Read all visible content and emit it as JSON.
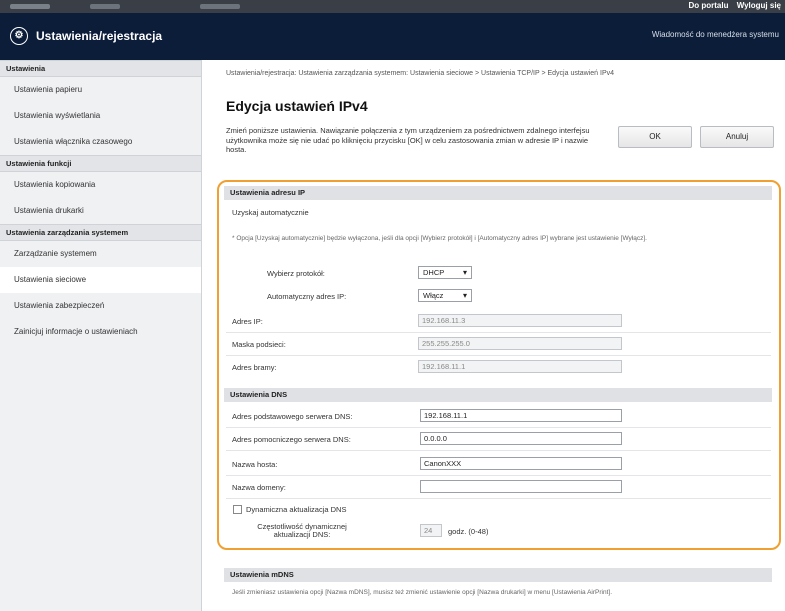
{
  "topbar": {
    "portal_link": "Do portalu",
    "logout_link": "Wyloguj się"
  },
  "app": {
    "title": "Ustawienia/rejestracja",
    "logo_icon": "settings-gear-icon",
    "admin_message": "Wiadomość do menedżera systemu"
  },
  "sidebar": {
    "sections": [
      {
        "label": "Ustawienia",
        "items": [
          "Ustawienia papieru",
          "Ustawienia wyświetlania",
          "Ustawienia włącznika czasowego"
        ]
      },
      {
        "label": "Ustawienia funkcji",
        "items": [
          "Ustawienia kopiowania",
          "Ustawienia drukarki"
        ]
      },
      {
        "label": "Ustawienia zarządzania systemem",
        "items": [
          "Zarządzanie systemem",
          "Ustawienia sieciowe",
          "Ustawienia zabezpieczeń",
          "Zainicjuj informacje o ustawieniach"
        ]
      }
    ],
    "active_item": "Ustawienia sieciowe"
  },
  "main": {
    "breadcrumb": "Ustawienia/rejestracja: Ustawienia zarządzania systemem: Ustawienia sieciowe > Ustawienia TCP/IP > Edycja ustawień IPv4",
    "page_title": "Edycja ustawień IPv4",
    "description": "Zmień poniższe ustawienia. Nawiązanie połączenia z tym urządzeniem za pośrednictwem zdalnego interfejsu użytkownika może się nie udać po kliknięciu przycisku [OK] w celu zastosowania zmian w adresie IP i nazwie hosta.",
    "ok_button": "OK",
    "cancel_button": "Anuluj"
  },
  "ip_settings": {
    "header": "Ustawienia adresu IP",
    "auto_label": "Uzyskaj automatycznie",
    "note": "* Opcja [Uzyskaj automatycznie] będzie wyłączona, jeśli dla opcji [Wybierz protokół] i [Automatyczny adres IP] wybrane jest ustawienie [Wyłącz].",
    "protocol_label": "Wybierz protokół:",
    "protocol_value": "DHCP",
    "auto_ip_label": "Automatyczny adres IP:",
    "auto_ip_value": "Włącz",
    "ip_label": "Adres IP:",
    "ip_value": "192.168.11.3",
    "mask_label": "Maska podsieci:",
    "mask_value": "255.255.255.0",
    "gateway_label": "Adres bramy:",
    "gateway_value": "192.168.11.1"
  },
  "dns_settings": {
    "header": "Ustawienia DNS",
    "primary_label": "Adres podstawowego serwera DNS:",
    "primary_value": "192.168.11.1",
    "secondary_label": "Adres pomocniczego serwera DNS:",
    "secondary_value": "0.0.0.0",
    "host_label": "Nazwa hosta:",
    "host_value": "CanonXXX",
    "domain_label": "Nazwa domeny:",
    "domain_value": "",
    "dynamic_label": "Dynamiczna aktualizacja DNS",
    "dynamic_checked": false,
    "interval_label": "Częstotliwość dynamicznej aktualizacji DNS:",
    "interval_value": "24",
    "interval_unit": "godz. (0-48)"
  },
  "mdns_settings": {
    "header": "Ustawienia mDNS",
    "note": "Jeśli zmieniasz ustawienia opcji [Nazwa mDNS], musisz też zmienić ustawienie opcji [Nazwa drukarki] w menu [Ustawienia AirPrint]."
  },
  "colors": {
    "highlight": "#f0a030",
    "title_bar": "#0c1d3a",
    "top_bar": "#3a3f47"
  }
}
